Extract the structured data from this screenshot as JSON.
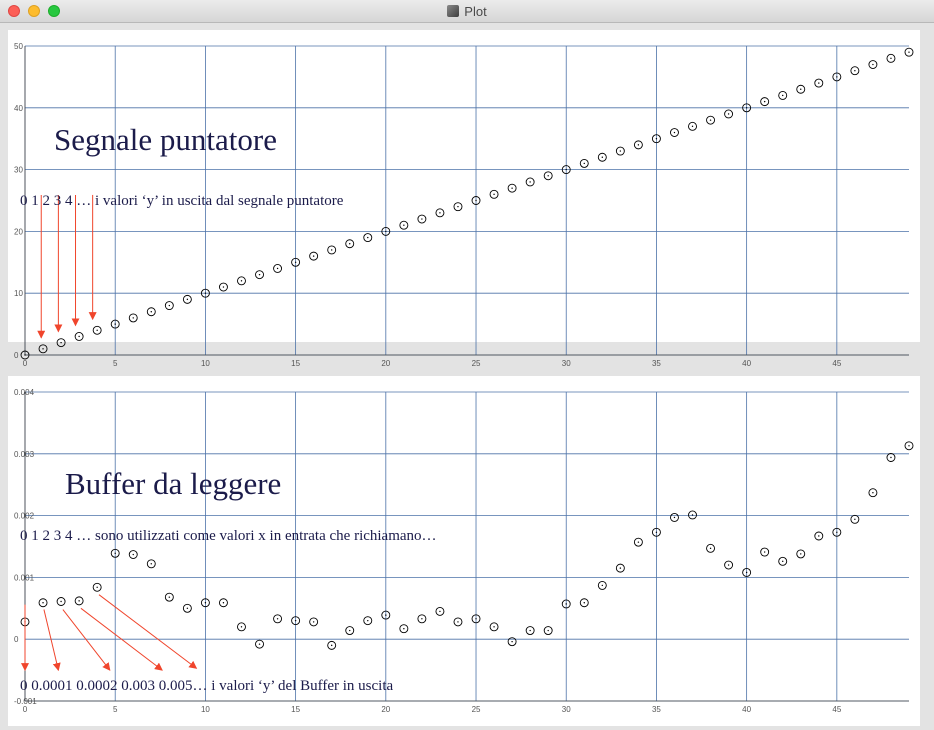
{
  "window": {
    "title": "Plot"
  },
  "colors": {
    "grid": "#4c72a8",
    "marker": "#000000",
    "annotation": "#1b1b4a",
    "arrow": "#f0452c"
  },
  "chart_data": [
    {
      "type": "scatter",
      "title": "",
      "xlabel": "",
      "ylabel": "",
      "xlim": [
        0,
        49
      ],
      "ylim": [
        0,
        50
      ],
      "x_ticks": [
        0,
        5,
        10,
        15,
        20,
        25,
        30,
        35,
        40,
        45
      ],
      "y_ticks": [
        0,
        10,
        20,
        30,
        40,
        50
      ],
      "x_tick_labels": [
        "0",
        "5",
        "10",
        "15",
        "20",
        "25",
        "30",
        "35",
        "40",
        "45"
      ],
      "y_tick_labels": [
        "0",
        "10",
        "20",
        "30",
        "40",
        "50"
      ],
      "grid": true,
      "series": [
        {
          "x": [
            0,
            1,
            2,
            3,
            4,
            5,
            6,
            7,
            8,
            9,
            10,
            11,
            12,
            13,
            14,
            15,
            16,
            17,
            18,
            19,
            20,
            21,
            22,
            23,
            24,
            25,
            26,
            27,
            28,
            29,
            30,
            31,
            32,
            33,
            34,
            35,
            36,
            37,
            38,
            39,
            40,
            41,
            42,
            43,
            44,
            45,
            46,
            47,
            48,
            49
          ],
          "values": [
            0,
            1,
            2,
            3,
            4,
            5,
            6,
            7,
            8,
            9,
            10,
            11,
            12,
            13,
            14,
            15,
            16,
            17,
            18,
            19,
            20,
            21,
            22,
            23,
            24,
            25,
            26,
            27,
            28,
            29,
            30,
            31,
            32,
            33,
            34,
            35,
            36,
            37,
            38,
            39,
            40,
            41,
            42,
            43,
            44,
            45,
            46,
            47,
            48,
            49
          ]
        }
      ],
      "annotations": {
        "heading": "Segnale puntatore",
        "line1": "0  1  2  3  4 … i valori ‘y’ in uscita dal segnale puntatore"
      },
      "arrows": [
        {
          "from": [
            0.9,
            25.9
          ],
          "to": [
            0.9,
            2.8
          ]
        },
        {
          "from": [
            1.85,
            25.9
          ],
          "to": [
            1.85,
            3.8
          ]
        },
        {
          "from": [
            2.8,
            25.9
          ],
          "to": [
            2.8,
            4.8
          ]
        },
        {
          "from": [
            3.75,
            25.9
          ],
          "to": [
            3.75,
            5.8
          ]
        }
      ]
    },
    {
      "type": "scatter",
      "title": "",
      "xlabel": "",
      "ylabel": "",
      "xlim": [
        0,
        49
      ],
      "ylim": [
        -0.001,
        0.004
      ],
      "x_ticks": [
        0,
        5,
        10,
        15,
        20,
        25,
        30,
        35,
        40,
        45
      ],
      "y_ticks": [
        -0.001,
        0,
        0.001,
        0.002,
        0.003,
        0.004
      ],
      "x_tick_labels": [
        "0",
        "5",
        "10",
        "15",
        "20",
        "25",
        "30",
        "35",
        "40",
        "45"
      ],
      "y_tick_labels": [
        "-0.001",
        "0",
        "0.001",
        "0.002",
        "0.003",
        "0.004"
      ],
      "grid": true,
      "series": [
        {
          "x": [
            0,
            1,
            2,
            3,
            4,
            5,
            6,
            7,
            8,
            9,
            10,
            11,
            12,
            13,
            14,
            15,
            16,
            17,
            18,
            19,
            20,
            21,
            22,
            23,
            24,
            25,
            26,
            27,
            28,
            29,
            30,
            31,
            32,
            33,
            34,
            35,
            36,
            37,
            38,
            39,
            40,
            41,
            42,
            43,
            44,
            45,
            46,
            47,
            48,
            49
          ],
          "values": [
            0.00028,
            0.00059,
            0.00061,
            0.00062,
            0.00084,
            0.00139,
            0.00137,
            0.00122,
            0.00068,
            0.0005,
            0.00059,
            0.00059,
            0.0002,
            -8e-05,
            0.00033,
            0.0003,
            0.00028,
            -0.0001,
            0.00014,
            0.0003,
            0.00039,
            0.00017,
            0.00033,
            0.00045,
            0.00028,
            0.00033,
            0.0002,
            -4e-05,
            0.00014,
            0.00014,
            0.00057,
            0.00059,
            0.00087,
            0.00115,
            0.00157,
            0.00173,
            0.00197,
            0.00201,
            0.00147,
            0.0012,
            0.00108,
            0.00141,
            0.00126,
            0.00138,
            0.00167,
            0.00173,
            0.00194,
            0.00237,
            0.00294,
            0.00313
          ]
        }
      ],
      "annotations": {
        "heading": "Buffer da leggere",
        "line1": "0  1  2  3  4 … sono utilizzati come valori x in entrata che richiamano…",
        "line2": "0   0.0001  0.0002  0.003  0.005… i valori ‘y’ del Buffer in uscita"
      },
      "arrows": [
        {
          "from": [
            0.0,
            0.00056
          ],
          "to": [
            0.0,
            -0.0005
          ]
        },
        {
          "from": [
            1.05,
            0.00048
          ],
          "to": [
            1.85,
            -0.0005
          ]
        },
        {
          "from": [
            2.1,
            0.00048
          ],
          "to": [
            4.7,
            -0.0005
          ]
        },
        {
          "from": [
            3.1,
            0.0005
          ],
          "to": [
            7.6,
            -0.0005
          ]
        },
        {
          "from": [
            4.1,
            0.00072
          ],
          "to": [
            9.5,
            -0.00047
          ]
        }
      ]
    }
  ]
}
